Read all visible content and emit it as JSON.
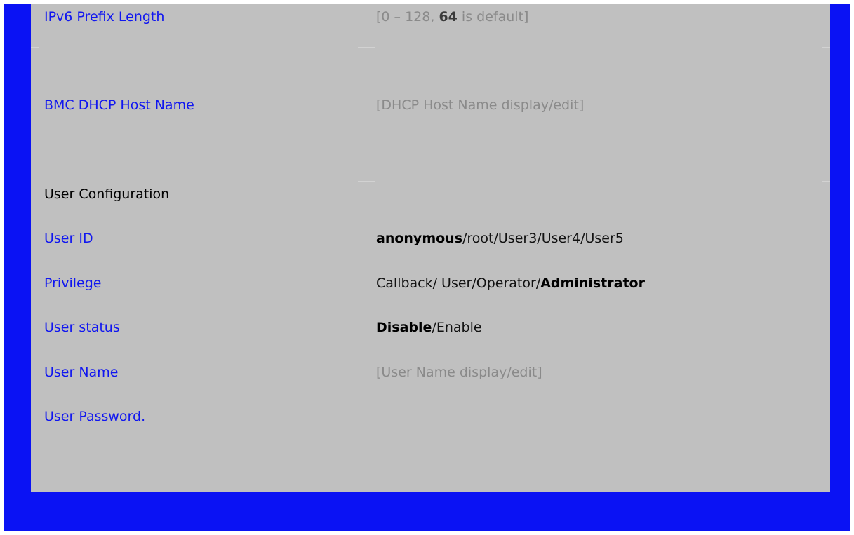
{
  "colors": {
    "frame": "#0a12f4",
    "panel": "#c0c0c0",
    "label": "#1016f0",
    "hint": "#8a8a8a",
    "value": "#111111"
  },
  "rows": {
    "ipv6_prefix": {
      "label": "IPv6 Prefix Length",
      "hint_pre": "[0 – 128, ",
      "hint_bold": "64",
      "hint_post": " is default]"
    },
    "dhcp_host": {
      "label": "BMC DHCP Host Name",
      "hint": "[DHCP Host Name display/edit]"
    },
    "user_config": {
      "label": "User Configuration"
    },
    "user_id": {
      "label": "User ID",
      "selected": "anonymous",
      "rest": "/root/User3/User4/User5"
    },
    "privilege": {
      "label": "Privilege",
      "rest": "Callback/ User/Operator/",
      "selected": "Administrator"
    },
    "user_status": {
      "label": "User status",
      "selected": "Disable",
      "rest": "/Enable"
    },
    "user_name": {
      "label": "User Name",
      "hint": "[User Name display/edit]"
    },
    "user_password": {
      "label": "User Password."
    }
  }
}
